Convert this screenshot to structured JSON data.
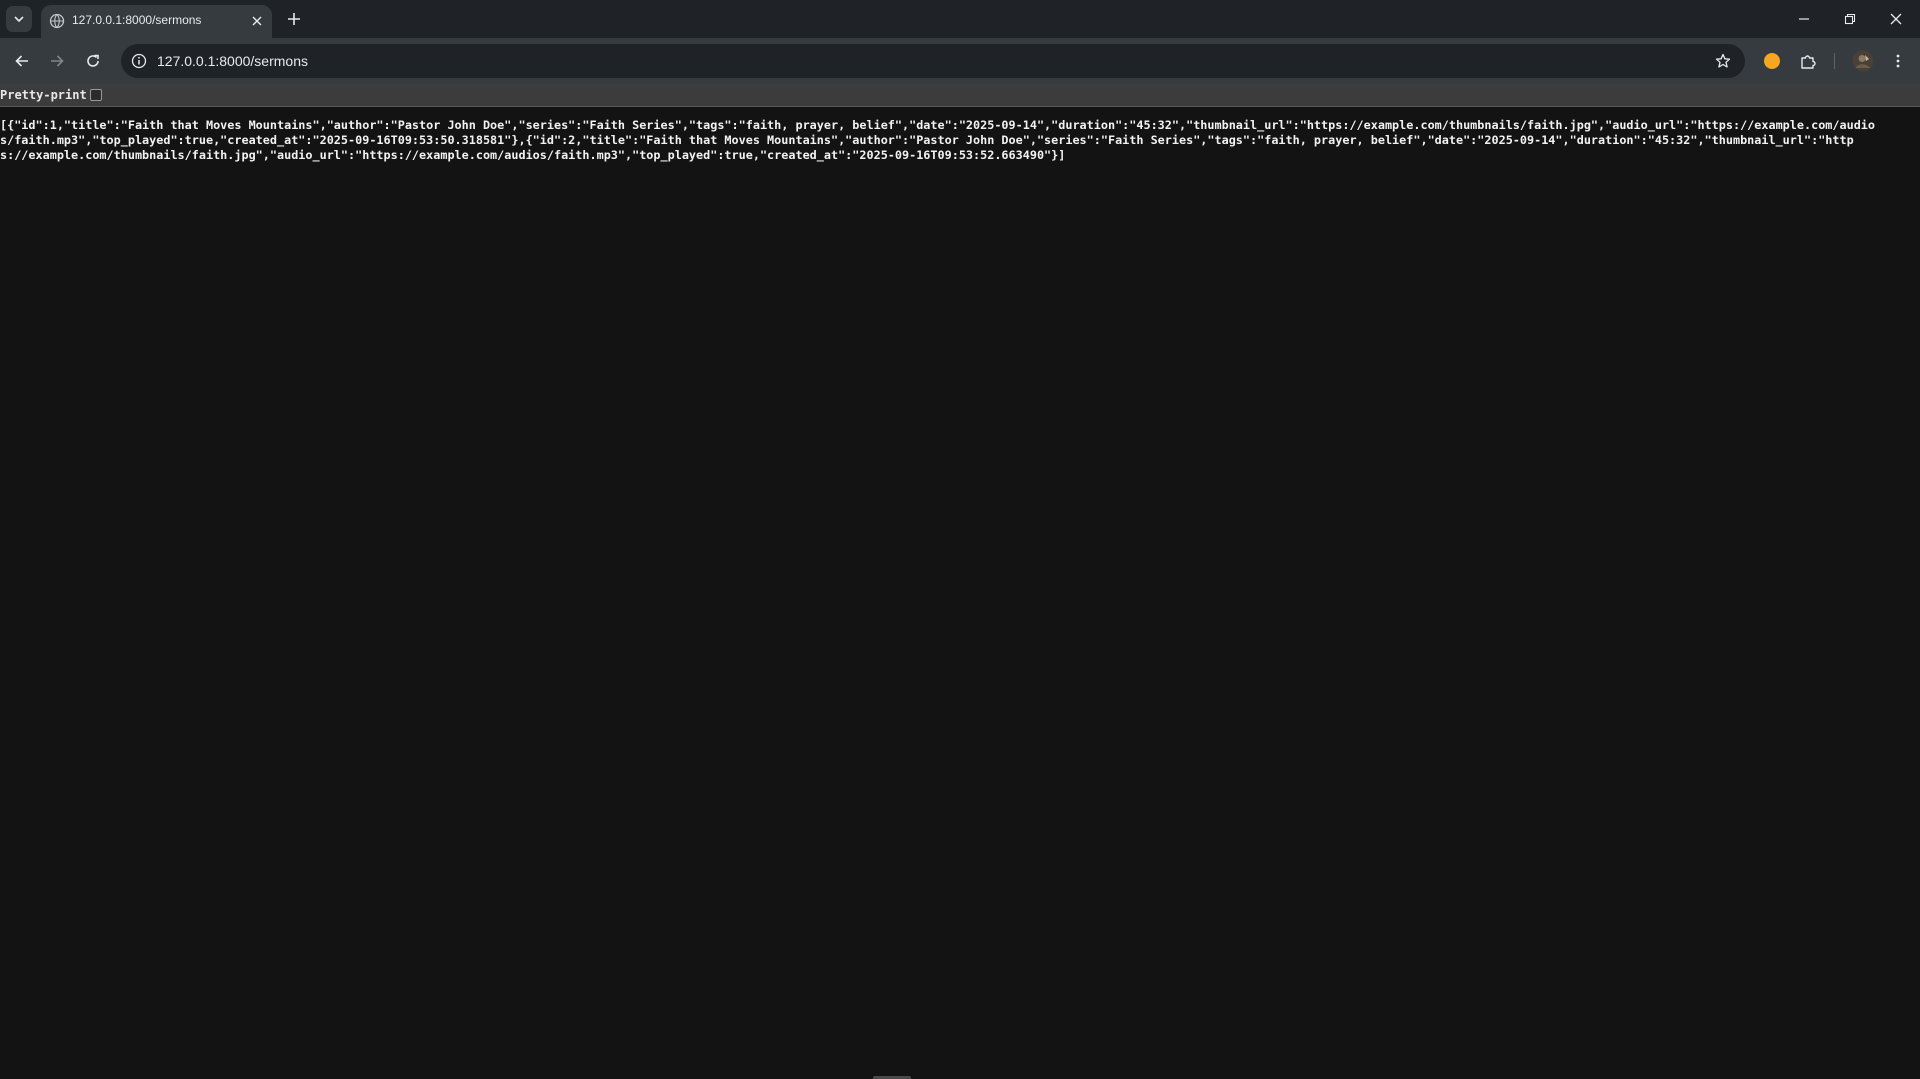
{
  "browser": {
    "tab": {
      "title": "127.0.0.1:8000/sermons"
    },
    "omnibox": {
      "url": "127.0.0.1:8000/sermons"
    },
    "icons": {
      "tab_search": "chevron-down-icon",
      "favicon": "globe-icon",
      "tab_close": "close-icon",
      "new_tab": "plus-icon",
      "minimize": "minimize-icon",
      "restore": "restore-icon",
      "close_window": "close-icon",
      "back": "arrow-left-icon",
      "forward": "arrow-right-icon",
      "reload": "reload-icon",
      "site_info": "info-icon",
      "bookmark": "star-icon",
      "extension_badge": "orange-circle-icon",
      "extensions": "puzzle-icon",
      "profile": "avatar",
      "menu": "kebab-menu-icon"
    },
    "colors": {
      "tabstrip": "#1f2327",
      "toolbar": "#363b40",
      "page_background": "#131313",
      "extension_badge": "#f5a623"
    }
  },
  "page": {
    "pretty_print_label": "Pretty-print",
    "pretty_print_checked": false,
    "json_text": "[{\"id\":1,\"title\":\"Faith that Moves Mountains\",\"author\":\"Pastor John Doe\",\"series\":\"Faith Series\",\"tags\":\"faith, prayer, belief\",\"date\":\"2025-09-14\",\"duration\":\"45:32\",\"thumbnail_url\":\"https://example.com/thumbnails/faith.jpg\",\"audio_url\":\"https://example.com/audios/faith.mp3\",\"top_played\":true,\"created_at\":\"2025-09-16T09:53:50.318581\"},{\"id\":2,\"title\":\"Faith that Moves Mountains\",\"author\":\"Pastor John Doe\",\"series\":\"Faith Series\",\"tags\":\"faith, prayer, belief\",\"date\":\"2025-09-14\",\"duration\":\"45:32\",\"thumbnail_url\":\"https://example.com/thumbnails/faith.jpg\",\"audio_url\":\"https://example.com/audios/faith.mp3\",\"top_played\":true,\"created_at\":\"2025-09-16T09:53:52.663490\"}]"
  }
}
